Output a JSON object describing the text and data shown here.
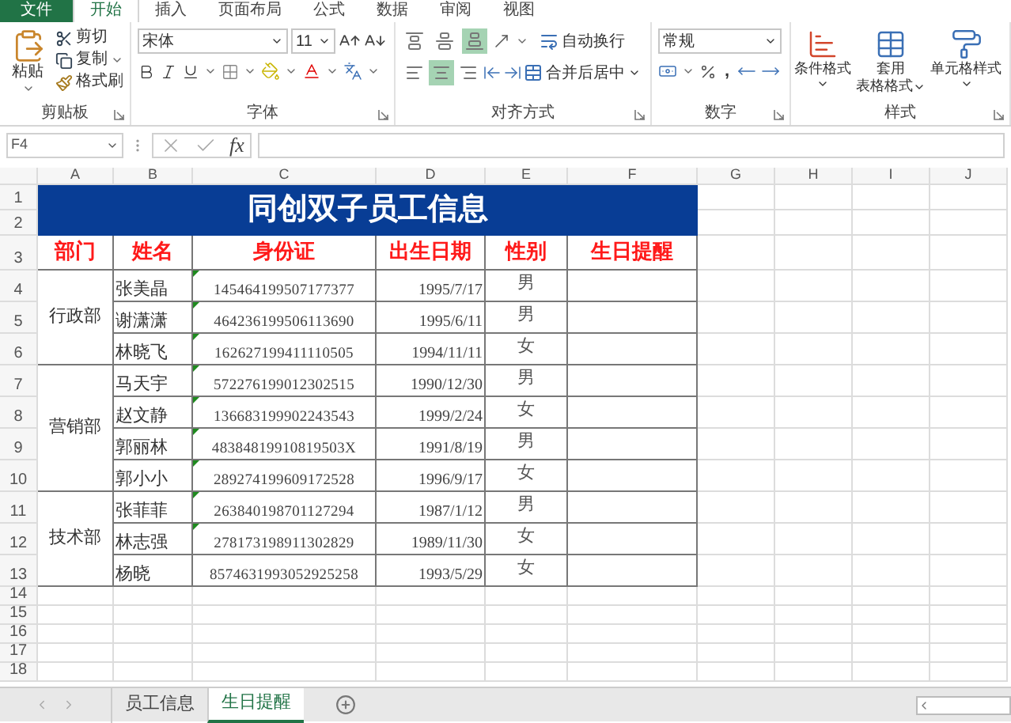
{
  "ribbon_tabs": [
    {
      "label": "文件",
      "kind": "file",
      "selected": false
    },
    {
      "label": "开始",
      "kind": "tab",
      "selected": true
    },
    {
      "label": "插入",
      "kind": "tab",
      "selected": false
    },
    {
      "label": "页面布局",
      "kind": "tab",
      "selected": false
    },
    {
      "label": "公式",
      "kind": "tab",
      "selected": false
    },
    {
      "label": "数据",
      "kind": "tab",
      "selected": false
    },
    {
      "label": "审阅",
      "kind": "tab",
      "selected": false
    },
    {
      "label": "视图",
      "kind": "tab",
      "selected": false
    }
  ],
  "clipboard": {
    "paste": "粘贴",
    "cut": "剪切",
    "copy": "复制",
    "format_painter": "格式刷",
    "title": "剪贴板"
  },
  "font": {
    "name": "宋体",
    "size": "11",
    "title": "字体"
  },
  "alignment": {
    "vertical": [
      {
        "selected": false
      },
      {
        "selected": false
      },
      {
        "selected": true
      }
    ],
    "horizontal": [
      {
        "selected": false
      },
      {
        "selected": true
      },
      {
        "selected": false
      }
    ],
    "wrap": "自动换行",
    "merge": "合并后居中",
    "title": "对齐方式"
  },
  "number": {
    "format": "常规",
    "comma": ",",
    "title": "数字"
  },
  "styles": {
    "conditional": "条件格式",
    "table_format": [
      "套用",
      "表格格式"
    ],
    "cell_styles": "单元格样式",
    "title": "样式"
  },
  "formula_bar": {
    "name_box": "F4",
    "fx": "fx"
  },
  "sheet": {
    "columns": [
      "A",
      "B",
      "C",
      "D",
      "E",
      "F",
      "G",
      "H",
      "I",
      "J"
    ],
    "row_numbers": [
      "1",
      "2",
      "3",
      "4",
      "5",
      "6",
      "7",
      "8",
      "9",
      "10",
      "11",
      "12",
      "13",
      "14",
      "15",
      "16",
      "17",
      "18"
    ],
    "title": "同创双子员工信息",
    "headers": [
      "部门",
      "姓名",
      "身份证",
      "出生日期",
      "性别",
      "生日提醒"
    ],
    "departments": [
      {
        "name": "行政部",
        "employees": [
          {
            "name": "张美晶",
            "id": "145464199507177377",
            "birth": "1995/7/17",
            "gender": "男",
            "flagged": true
          },
          {
            "name": "谢潇潇",
            "id": "464236199506113690",
            "birth": "1995/6/11",
            "gender": "男",
            "flagged": true
          },
          {
            "name": "林晓飞",
            "id": "162627199411110505",
            "birth": "1994/11/11",
            "gender": "女",
            "flagged": true
          }
        ]
      },
      {
        "name": "营销部",
        "employees": [
          {
            "name": "马天宇",
            "id": "572276199012302515",
            "birth": "1990/12/30",
            "gender": "男",
            "flagged": true
          },
          {
            "name": "赵文静",
            "id": "136683199902243543",
            "birth": "1999/2/24",
            "gender": "女",
            "flagged": true
          },
          {
            "name": "郭丽林",
            "id": "48384819910819503X",
            "birth": "1991/8/19",
            "gender": "男",
            "flagged": true
          },
          {
            "name": "郭小小",
            "id": "289274199609172528",
            "birth": "1996/9/17",
            "gender": "女",
            "flagged": true
          }
        ]
      },
      {
        "name": "技术部",
        "employees": [
          {
            "name": "张菲菲",
            "id": "263840198701127294",
            "birth": "1987/1/12",
            "gender": "男",
            "flagged": true
          },
          {
            "name": "林志强",
            "id": "278173198911302829",
            "birth": "1989/11/30",
            "gender": "女",
            "flagged": true
          },
          {
            "name": "杨晓",
            "id": "8574631993052925258",
            "birth": "1993/5/29",
            "gender": "女",
            "flagged": false
          }
        ]
      }
    ]
  },
  "sheet_tabs": [
    {
      "label": "员工信息",
      "selected": false
    },
    {
      "label": "生日提醒",
      "selected": true
    }
  ]
}
